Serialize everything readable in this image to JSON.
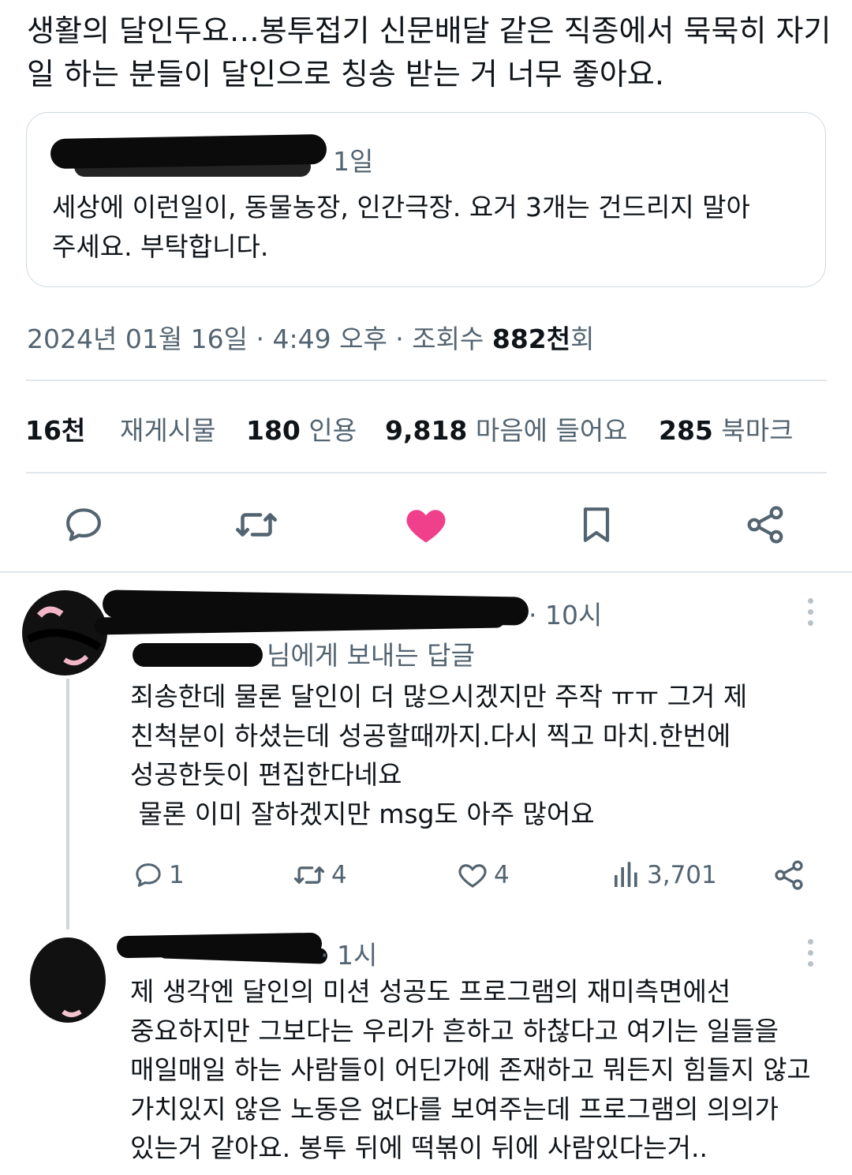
{
  "tweet": {
    "text": "생활의 달인두요…봉투접기 신문배달 같은 직종에서 묵묵히 자기 일 하는 분들이 달인으로 칭송 받는 거 너무 좋아요.",
    "quoted": {
      "time": "1일",
      "text": "세상에 이런일이, 동물농장, 인간극장. 요거 3개는 건드리지 말아주세요. 부탁합니다."
    },
    "meta": {
      "date": "2024년 01월 16일 · 4:49 오후 · 조회수 ",
      "views": "882천",
      "views_suffix": "회"
    },
    "stats": {
      "retweets_num": "16천",
      "retweets_label": "재게시물",
      "quotes_num": "180",
      "quotes_label": "인용",
      "likes_num": "9,818",
      "likes_label": "마음에 들어요",
      "bookmarks_num": "285",
      "bookmarks_label": "북마크"
    },
    "like_color": "#f0408b"
  },
  "replies": [
    {
      "time": "· 10시",
      "reply_to": "님에게 보내는 답글",
      "lines": [
        "죄송한데 물론 달인이 더 많으시겠지만 주작 ㅠㅠ 그거 제",
        "친척분이 하셨는데 성공할때까지.다시 찍고 마치.한번에",
        "성공한듯이 편집한다네요",
        " 물론 이미 잘하겠지만 msg도 아주 많어요"
      ],
      "replies": "1",
      "retweets": "4",
      "likes": "4",
      "views": "3,701"
    },
    {
      "time": "· 1시",
      "lines": [
        "제 생각엔 달인의 미션 성공도 프로그램의 재미측면에선",
        "중요하지만 그보다는 우리가 흔하고 하찮다고 여기는 일들을",
        "매일매일 하는 사람들이 어딘가에 존재하고 뭐든지 힘들지 않고",
        "가치있지 않은 노동은 없다를 보여주는데 프로그램의 의의가",
        "있는거 같아요. 봉투 뒤에 떡볶이 뒤에 사람있다는거.."
      ]
    }
  ]
}
